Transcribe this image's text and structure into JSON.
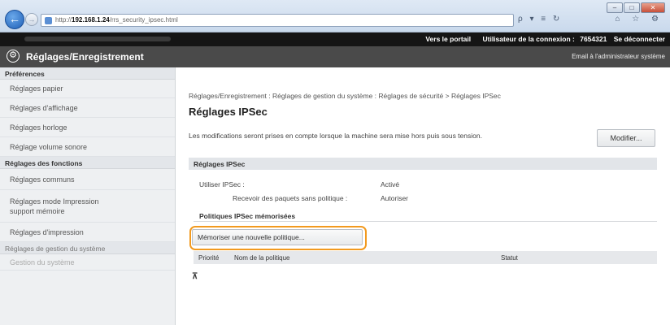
{
  "browser": {
    "url_prefix": "http://",
    "url_host": "192.168.1.24",
    "url_path": "/rrs_security_ipsec.html",
    "addr_tools": "ρ ▾ ≡ ↻",
    "fav_tools": "⌂ ☆ ⚙",
    "win_min": "–",
    "win_max": "□",
    "win_close": "✕"
  },
  "topbar": {
    "portal": "Vers le portail",
    "user_label": "Utilisateur de la connexion :",
    "user_id": "7654321",
    "logout": "Se déconnecter"
  },
  "titlebar": {
    "title": "Réglages/Enregistrement",
    "mail": "Email à l'administrateur système"
  },
  "sidebar": {
    "sections": [
      {
        "heading": "Préférences",
        "items": [
          "Réglages papier",
          "Réglages d'affichage",
          "Réglages horloge",
          "Réglage volume sonore"
        ]
      },
      {
        "heading": "Réglages des fonctions",
        "items": [
          "Réglages communs",
          "Réglages mode Impression support mémoire",
          "Réglages d'impression"
        ]
      }
    ],
    "more": "Réglages de gestion du système",
    "more2": "Gestion du système"
  },
  "main": {
    "breadcrumb": "Réglages/Enregistrement : Réglages de gestion du système : Réglages de sécurité > Réglages IPSec",
    "title": "Réglages IPSec",
    "description": "Les modifications seront prises en compte lorsque la machine sera mise hors puis sous tension.",
    "modify_button": "Modifier...",
    "section_title": "Réglages IPSec",
    "use_ipsec_label": "Utiliser IPSec :",
    "use_ipsec_value": "Activé",
    "receive_label": "Recevoir des paquets sans politique :",
    "receive_value": "Autoriser",
    "policies_heading": "Politiques IPSec mémorisées",
    "register_button": "Mémoriser une nouvelle politique...",
    "table_headers": [
      "Priorité",
      "Nom de la politique",
      "Statut"
    ]
  }
}
